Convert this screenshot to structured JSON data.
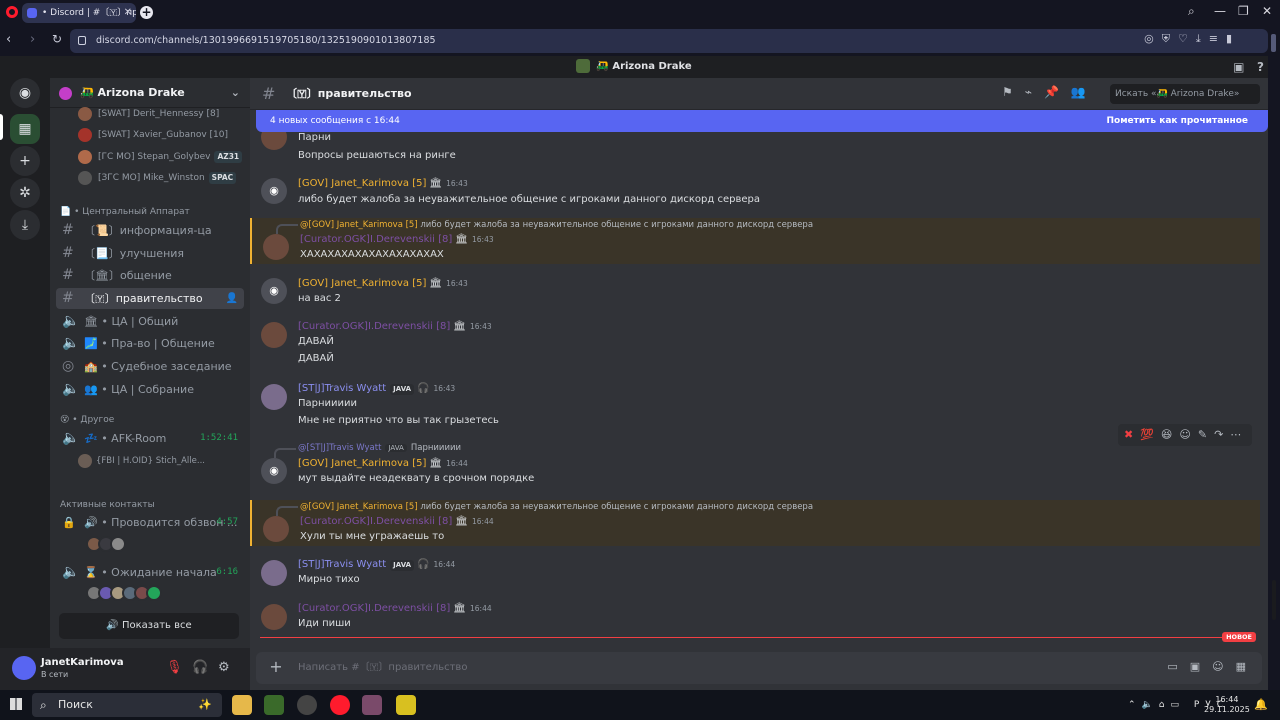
{
  "browser": {
    "tab_title": "• Discord | #〔🇾〕правите",
    "url": "discord.com/channels/1301996691519705180/1325190901013807185"
  },
  "app": {
    "title": "🛺 Arizona Drake"
  },
  "server": {
    "name": "🛺 Arizona Drake"
  },
  "top_members": [
    {
      "name": "[SWAT] Derit_Hennessy [8]",
      "tag": ""
    },
    {
      "name": "[SWAT] Xavier_Gubanov [10]",
      "tag": ""
    },
    {
      "name": "[ГС МО] Stepan_Golybev",
      "tag": "AZ31"
    },
    {
      "name": "[ЗГС МО] Mike_Winston",
      "tag": "SPAC"
    }
  ],
  "categories": {
    "central": "📄 • Центральный Аппарат",
    "other": "😵 • Другое"
  },
  "channels": [
    {
      "name": "〔📜〕информация-ца"
    },
    {
      "name": "〔📃〕улучшения"
    },
    {
      "name": "〔🏛〕общение"
    },
    {
      "name": "〔🇾〕правительство"
    }
  ],
  "voice_channels": [
    {
      "name": "🏛 • ЦА | Общий"
    },
    {
      "name": "🗾 • Пра-во | Общение"
    },
    {
      "name": "🏫 • Судебное заседание"
    },
    {
      "name": "👥 • ЦА | Собрание"
    }
  ],
  "afk": {
    "name": "💤 • AFK-Room",
    "time": "1:52:41",
    "user": "{FBI | H.OID} Stich_Alle..."
  },
  "active_contacts": {
    "header": "Активные контакты",
    "items": [
      {
        "name": "🔊 • Проводится обзвон ...",
        "time": "4:57"
      },
      {
        "name": "⌛ • Ожидание начала",
        "time": "6:16"
      }
    ],
    "show_all": "Показать все"
  },
  "user": {
    "name": "JanetKarimova",
    "status": "В сети"
  },
  "channel_header": {
    "name": "〔🇾〕правительство",
    "search_placeholder": "Искать «🛺 Arizona Drake»"
  },
  "banner": {
    "text": "4 новых сообщения с 16:44",
    "mark_read": "Пометить как прочитанное"
  },
  "messages": [
    {
      "lines": [
        "Парни",
        "Вопросы решаються на ринге"
      ]
    },
    {
      "author": "[GOV] Janet_Karimova [5]",
      "time": "16:43",
      "text": "либо будет жалоба за неуважительное общение с игроками данного дискорд сервера"
    },
    {
      "reply_to": "@[GOV] Janet_Karimova [5]",
      "reply_text": "либо будет жалоба за неуважительное общение с игроками данного дискорд сервера",
      "author": "[Curator.OGK]I.Derevenskii [8]",
      "time": "16:43",
      "text": "ХАХАХАХАХАХАХАХАХАХАХ"
    },
    {
      "author": "[GOV] Janet_Karimova [5]",
      "time": "16:43",
      "text": "на вас 2"
    },
    {
      "author": "[Curator.OGK]I.Derevenskii [8]",
      "time": "16:43",
      "lines": [
        "ДАВАЙ",
        "ДАВАЙ"
      ]
    },
    {
      "author": "[ST|J]Travis Wyatt",
      "badge": "JAVA",
      "time": "16:43",
      "lines": [
        "Парниииии",
        "Мне не приятно что вы так грызетесь"
      ]
    },
    {
      "reply_to": "@[ST|J]Travis Wyatt",
      "reply_badge": "JAVA",
      "reply_text": "Парниииии",
      "author": "[GOV] Janet_Karimova [5]",
      "time": "16:44",
      "text": "мут выдайте неадеквату в срочном порядке"
    },
    {
      "reply_to": "@[GOV] Janet_Karimova [5]",
      "reply_text": "либо будет жалоба за неуважительное общение с игроками данного дискорд сервера",
      "author": "[Curator.OGK]I.Derevenskii [8]",
      "time": "16:44",
      "text": "Хули ты мне угражаешь то"
    },
    {
      "author": "[ST|J]Travis Wyatt",
      "badge": "JAVA",
      "time": "16:44",
      "text": "Мирно тихо"
    },
    {
      "author": "[Curator.OGK]I.Derevenskii [8]",
      "time": "16:44",
      "text": "Иди пиши"
    }
  ],
  "new_label": "НОВОЕ",
  "composer": {
    "placeholder": "Написать #〔🇾〕правительство"
  },
  "taskbar": {
    "search": "Поиск",
    "lang": "РУС",
    "time": "16:44",
    "date": "29.11.2025"
  },
  "colors": {
    "gov": "#f0b232",
    "curator": "#7d4fa3",
    "travis": "#8b8ff0",
    "accent": "#5865f2",
    "new_line": "#f23f43"
  }
}
